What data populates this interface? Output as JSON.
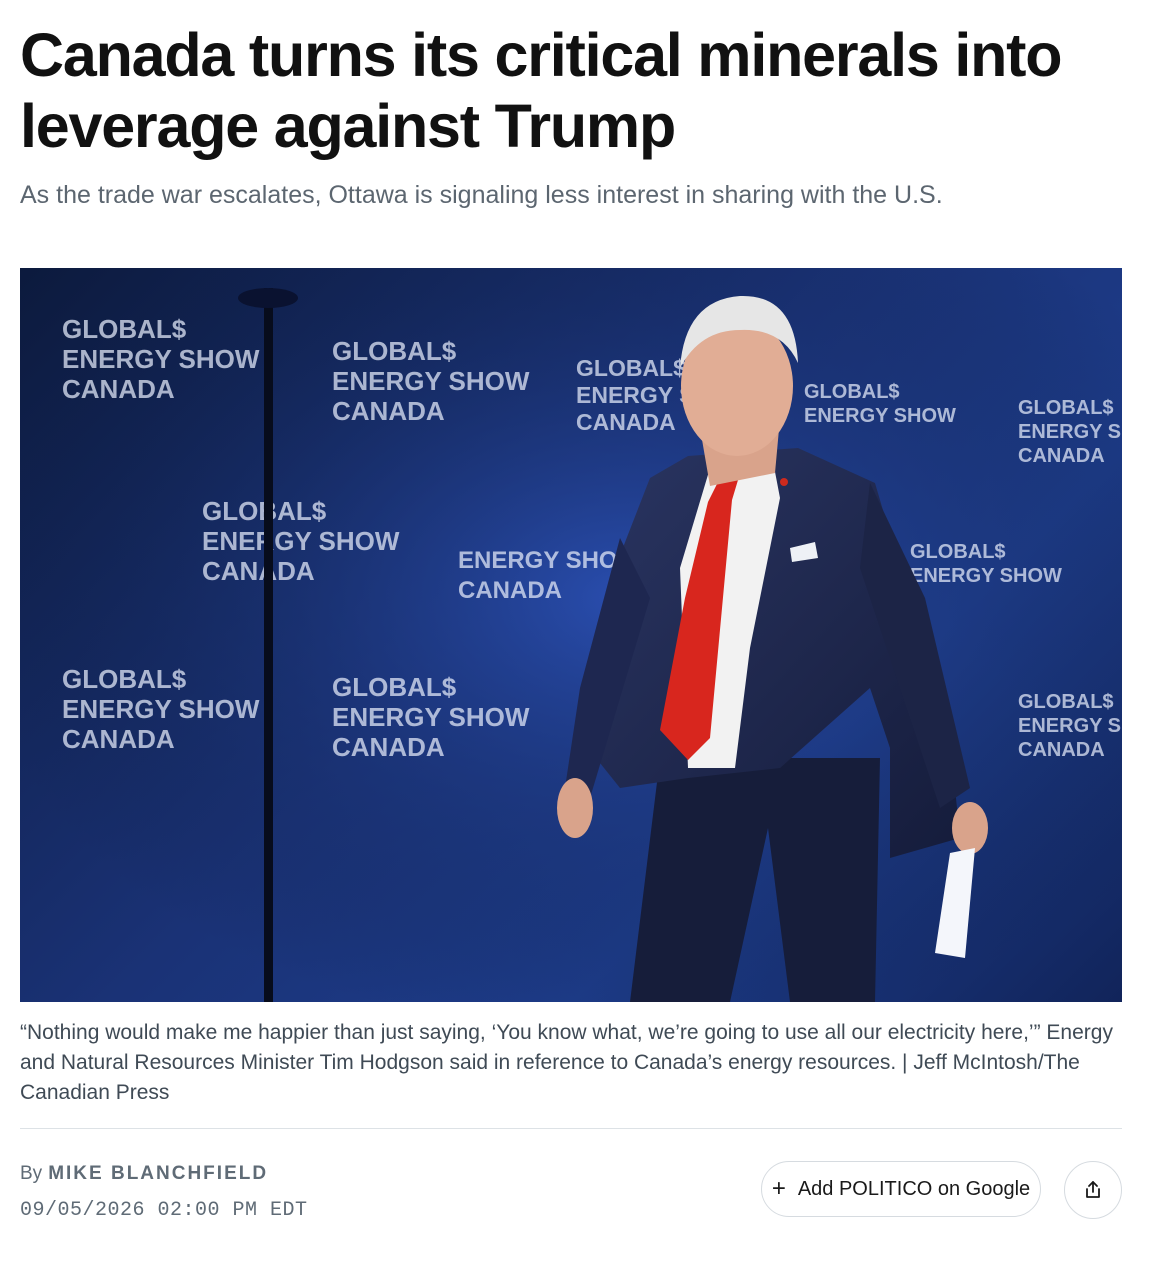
{
  "article": {
    "headline": "Canada turns its critical minerals into leverage against Trump",
    "dek": "As the trade war escalates, Ottawa is signaling less interest in sharing with the U.S."
  },
  "photo": {
    "backdrop_text": "GLOBAL$ ENERGY SHOW CANADA",
    "backdrop_line1": "GLOBAL$",
    "backdrop_line2": "ENERGY SHOW",
    "backdrop_line3": "CANADA",
    "colors": {
      "backdrop": "#1a3276",
      "suit": "#1c2548",
      "tie": "#d8261e",
      "shirt": "#f2f2f2"
    }
  },
  "caption": {
    "text": "“Nothing would make me happier than just saying, ‘You know what, we’re going to use all our electricity here,’” Energy and Natural Resources Minister Tim Hodgson said in reference to Canada’s energy resources. | Jeff McIntosh/The Canadian Press"
  },
  "byline": {
    "prefix": "By",
    "author": "MIKE BLANCHFIELD",
    "timestamp": "09/05/2026 02:00 PM EDT"
  },
  "actions": {
    "add_google_icon": "plus-icon",
    "add_google_label": "Add POLITICO on Google",
    "share_icon": "share-icon"
  }
}
